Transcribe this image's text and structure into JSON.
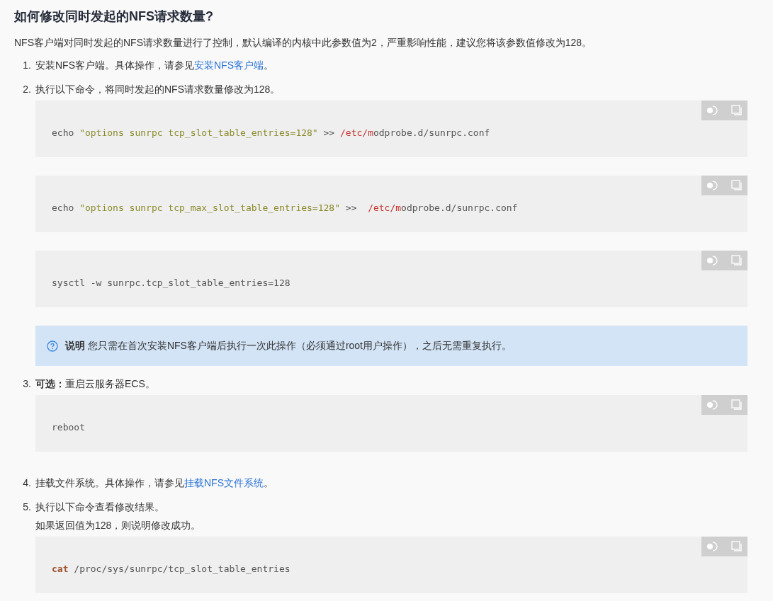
{
  "title": "如何修改同时发起的NFS请求数量?",
  "intro": "NFS客户端对同时发起的NFS请求数量进行了控制，默认编译的内核中此参数值为2，严重影响性能，建议您将该参数值修改为128。",
  "steps": [
    {
      "number": "1.",
      "text": "安装NFS客户端。具体操作，请参见",
      "link": "安装NFS客户端",
      "after": "。"
    },
    {
      "number": "2.",
      "text": "执行以下命令，将同时发起的NFS请求数量修改为128。",
      "blocks": [
        {
          "kind": "code",
          "segments": [
            {
              "kind": "plain",
              "text": "echo "
            },
            {
              "kind": "string",
              "text": "\"options sunrpc tcp_slot_table_entries=128\""
            },
            {
              "kind": "plain",
              "text": " >> "
            },
            {
              "kind": "path",
              "text": "/etc/m"
            },
            {
              "kind": "plain",
              "text": "odprobe.d/sunrpc.conf"
            }
          ]
        },
        {
          "kind": "code",
          "segments": [
            {
              "kind": "plain",
              "text": "echo "
            },
            {
              "kind": "string",
              "text": "\"options sunrpc tcp_max_slot_table_entries=128\""
            },
            {
              "kind": "plain",
              "text": " >>  "
            },
            {
              "kind": "path",
              "text": "/etc/m"
            },
            {
              "kind": "plain",
              "text": "odprobe.d/sunrpc.conf"
            }
          ]
        },
        {
          "kind": "code",
          "segments": [
            {
              "kind": "plain",
              "text": "sysctl -w sunrpc.tcp_slot_table_entries=128"
            }
          ]
        },
        {
          "kind": "note",
          "text": "**说明** 您只需在首次安装NFS客户端后执行一次此操作（必须通过root用户操作），之后无需重复执行。"
        }
      ]
    },
    {
      "number": "3.",
      "text": "**可选：**重启云服务器ECS。",
      "blocks": [
        {
          "kind": "code",
          "segments": [
            {
              "kind": "plain",
              "text": "reboot"
            }
          ]
        }
      ]
    },
    {
      "number": "4.",
      "text": "挂载文件系统。具体操作，请参见",
      "link": "挂载NFS文件系统",
      "after": "。"
    },
    {
      "number": "5.",
      "text": "执行以下命令查看修改结果。",
      "blocks": [
        {
          "kind": "text",
          "text": "如果返回值为128，则说明修改成功。"
        },
        {
          "kind": "code",
          "segments": [
            {
              "kind": "keyword",
              "text": "cat"
            },
            {
              "kind": "plain",
              "text": " /proc/sys/sunrpc/tcp_slot_table_entries"
            }
          ]
        }
      ]
    }
  ]
}
